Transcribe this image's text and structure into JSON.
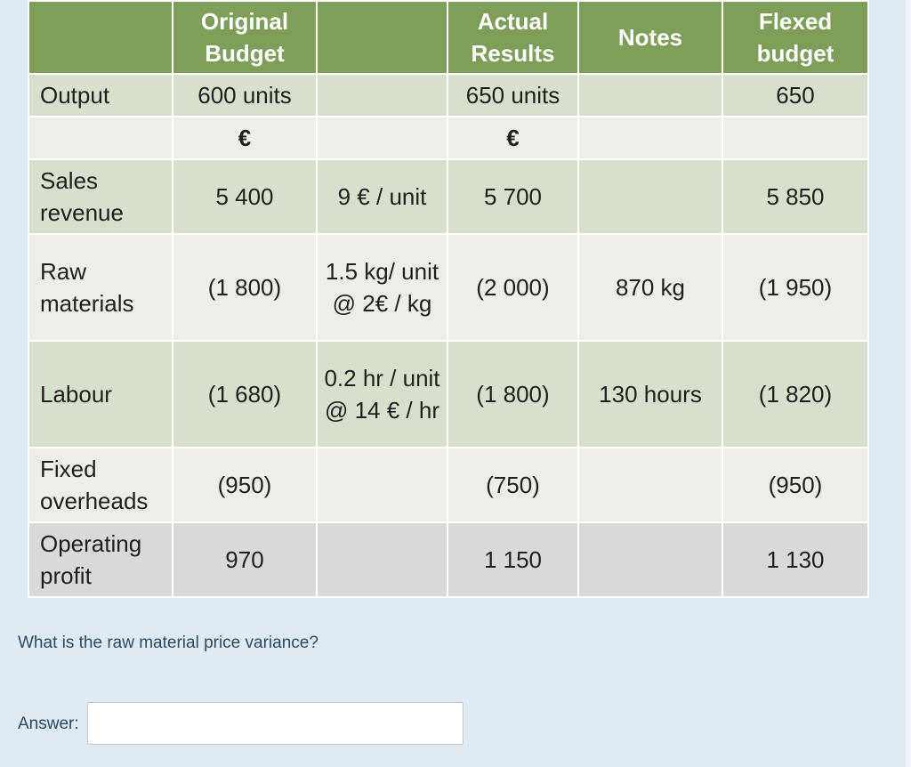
{
  "table": {
    "headers": [
      "",
      "Original Budget",
      "",
      "Actual Results",
      "Notes",
      "Flexed budget"
    ],
    "rows": [
      [
        "Output",
        "600 units",
        "",
        "650 units",
        "",
        "650"
      ],
      [
        "",
        "€",
        "",
        "€",
        "",
        ""
      ],
      [
        "Sales revenue",
        "5 400",
        "9 € / unit",
        "5 700",
        "",
        "5 850"
      ],
      [
        "Raw materials",
        "(1 800)",
        "1.5 kg/ unit @ 2€ / kg",
        "(2 000)",
        "870 kg",
        "(1 950)"
      ],
      [
        "Labour",
        "(1 680)",
        "0.2 hr / unit @ 14 € / hr",
        "(1 800)",
        "130 hours",
        "(1 820)"
      ],
      [
        "Fixed overheads",
        "(950)",
        "",
        "(750)",
        "",
        "(950)"
      ],
      [
        "Operating profit",
        "970",
        "",
        "1 150",
        "",
        "1 130"
      ]
    ]
  },
  "question": {
    "text": "What is the raw material price variance?",
    "answer_label": "Answer:",
    "answer_value": ""
  },
  "colors": {
    "header_bg": "#7f9e5a",
    "row_dark": "#d7e0cd",
    "row_light": "#ebefe7",
    "row_total": "#d9d9d9",
    "page_bg": "#dfeaf3"
  }
}
